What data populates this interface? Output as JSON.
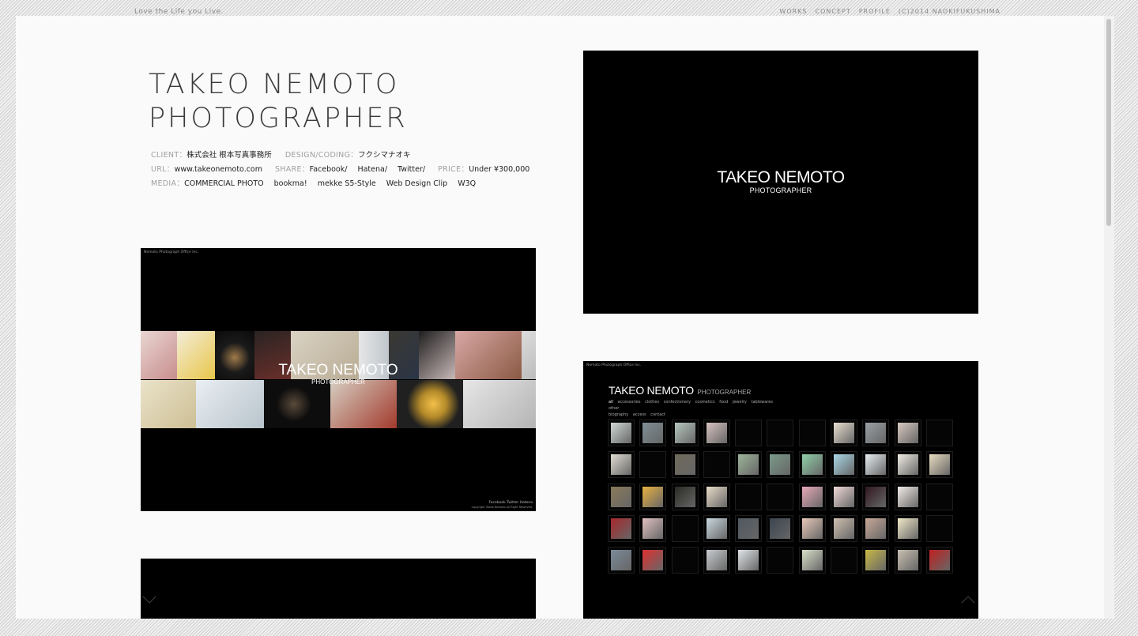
{
  "header": {
    "tagline": "Love the Life you Live.",
    "nav": [
      "WORKS",
      "CONCEPT",
      "PROFILE"
    ],
    "copyright": "(C)2014 NAOKIFUKUSHIMA"
  },
  "project": {
    "title_line1": "TAKEO NEMOTO",
    "title_line2": "PHOTOGRAPHER",
    "client_label": "CLIENT：",
    "client": "株式会社 根本写真事務所",
    "design_label": "DESIGN/CODING：",
    "design": "フクシマナオキ",
    "url_label": "URL：",
    "url": "www.takeonemoto.com",
    "share_label": "SHARE：",
    "share": [
      "Facebook/",
      "Hatena/",
      "Twitter/"
    ],
    "price_label": "PRICE：",
    "price": "Under ¥300,000",
    "media_label": "MEDIA：",
    "media": [
      "COMMERCIAL PHOTO",
      "bookma!",
      "mekke S5-Style",
      "Web Design Clip",
      "W3Q"
    ]
  },
  "screenshots": {
    "top": {
      "logo_line1": "TAKEO NEMOTO",
      "logo_line2": "PHOTOGRAPHER"
    },
    "mosaic": {
      "office": "Nemoto Photograph Office Inc.",
      "logo_line1": "TAKEO NEMOTO",
      "logo_line2": "PHOTOGRAPHER",
      "footer_links": "Facebook   Twitter   Hatena",
      "footer_copy": "Copyright Takeo Nemoto All Right Reserved."
    },
    "gallery": {
      "office": "Nemoto Photograph Office Inc.",
      "title": "TAKEO NEMOTO",
      "subtitle": "PHOTOGRAPHER",
      "categories": [
        "all",
        "accessories",
        "clothes",
        "confectionery",
        "cosmetics",
        "food",
        "jewelry",
        "tablewares",
        "other",
        "biography",
        "access",
        "contact"
      ]
    }
  },
  "colors": {
    "panel_bg": "#fafafa",
    "screen_bg": "#000000",
    "label_gray": "#a0a0a0",
    "text_dark": "#222222"
  },
  "icons": {
    "scroll_down": "chevron-down-icon",
    "scroll_up": "chevron-up-icon"
  }
}
